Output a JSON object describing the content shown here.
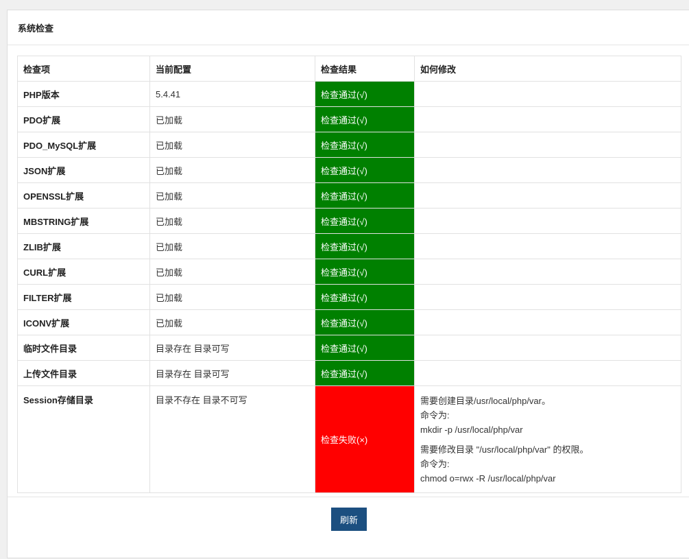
{
  "panel": {
    "title": "系统检查"
  },
  "table": {
    "headers": [
      "检查项",
      "当前配置",
      "检查结果",
      "如何修改"
    ],
    "rows": [
      {
        "item": "PHP版本",
        "config": "5.4.41",
        "result": "检查通过(√)"
      },
      {
        "item": "PDO扩展",
        "config": "已加载",
        "result": "检查通过(√)"
      },
      {
        "item": "PDO_MySQL扩展",
        "config": "已加载",
        "result": "检查通过(√)"
      },
      {
        "item": "JSON扩展",
        "config": "已加载",
        "result": "检查通过(√)"
      },
      {
        "item": "OPENSSL扩展",
        "config": "已加载",
        "result": "检查通过(√)"
      },
      {
        "item": "MBSTRING扩展",
        "config": "已加载",
        "result": "检查通过(√)"
      },
      {
        "item": "ZLIB扩展",
        "config": "已加载",
        "result": "检查通过(√)"
      },
      {
        "item": "CURL扩展",
        "config": "已加载",
        "result": "检查通过(√)"
      },
      {
        "item": "FILTER扩展",
        "config": "已加载",
        "result": "检查通过(√)"
      },
      {
        "item": "ICONV扩展",
        "config": "已加载",
        "result": "检查通过(√)"
      },
      {
        "item": "临时文件目录",
        "config": "目录存在 目录可写",
        "result": "检查通过(√)"
      },
      {
        "item": "上传文件目录",
        "config": "目录存在 目录可写",
        "result": "检查通过(√)"
      }
    ],
    "session_row": {
      "item": "Session存储目录",
      "config": "目录不存在 目录不可写",
      "result": "检查失败(×)",
      "fix1_line1": "需要创建目录/usr/local/php/var。",
      "fix1_line2": "命令为:",
      "fix1_line3": "mkdir -p /usr/local/php/var",
      "fix2_line1": "需要修改目录 \"/usr/local/php/var\" 的权限。",
      "fix2_line2": "命令为:",
      "fix2_line3": "chmod o=rwx -R /usr/local/php/var"
    }
  },
  "footer": {
    "refresh_label": "刷新"
  },
  "colors": {
    "pass": "#008000",
    "fail": "#ff0000",
    "button": "#1c4f80"
  }
}
